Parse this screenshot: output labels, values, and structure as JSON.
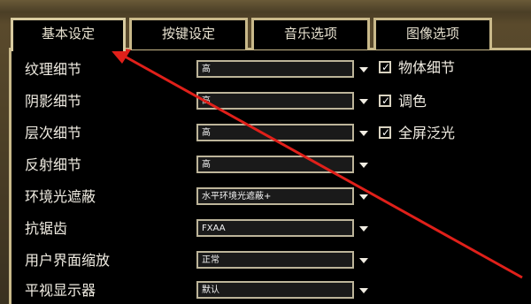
{
  "tabs": [
    {
      "label": "基本设定",
      "active": true
    },
    {
      "label": "按键设定",
      "active": false
    },
    {
      "label": "音乐选项",
      "active": false
    },
    {
      "label": "图像选项",
      "active": false
    }
  ],
  "settings": [
    {
      "label": "纹理细节",
      "value": "高"
    },
    {
      "label": "阴影细节",
      "value": "高"
    },
    {
      "label": "层次细节",
      "value": "高"
    },
    {
      "label": "反射细节",
      "value": "高"
    },
    {
      "label": "环境光遮蔽",
      "value": "水平环境光遮蔽+"
    },
    {
      "label": "抗锯齿",
      "value": "FXAA"
    },
    {
      "label": "用户界面缩放",
      "value": "正常"
    },
    {
      "label": "平视显示器",
      "value": "默认"
    }
  ],
  "checkboxes": [
    {
      "label": "物体细节",
      "checked": true
    },
    {
      "label": "调色",
      "checked": true
    },
    {
      "label": "全屏泛光",
      "checked": true
    }
  ],
  "colors": {
    "accent_border": "#c9b98a",
    "annotation_arrow": "#e0201a"
  }
}
